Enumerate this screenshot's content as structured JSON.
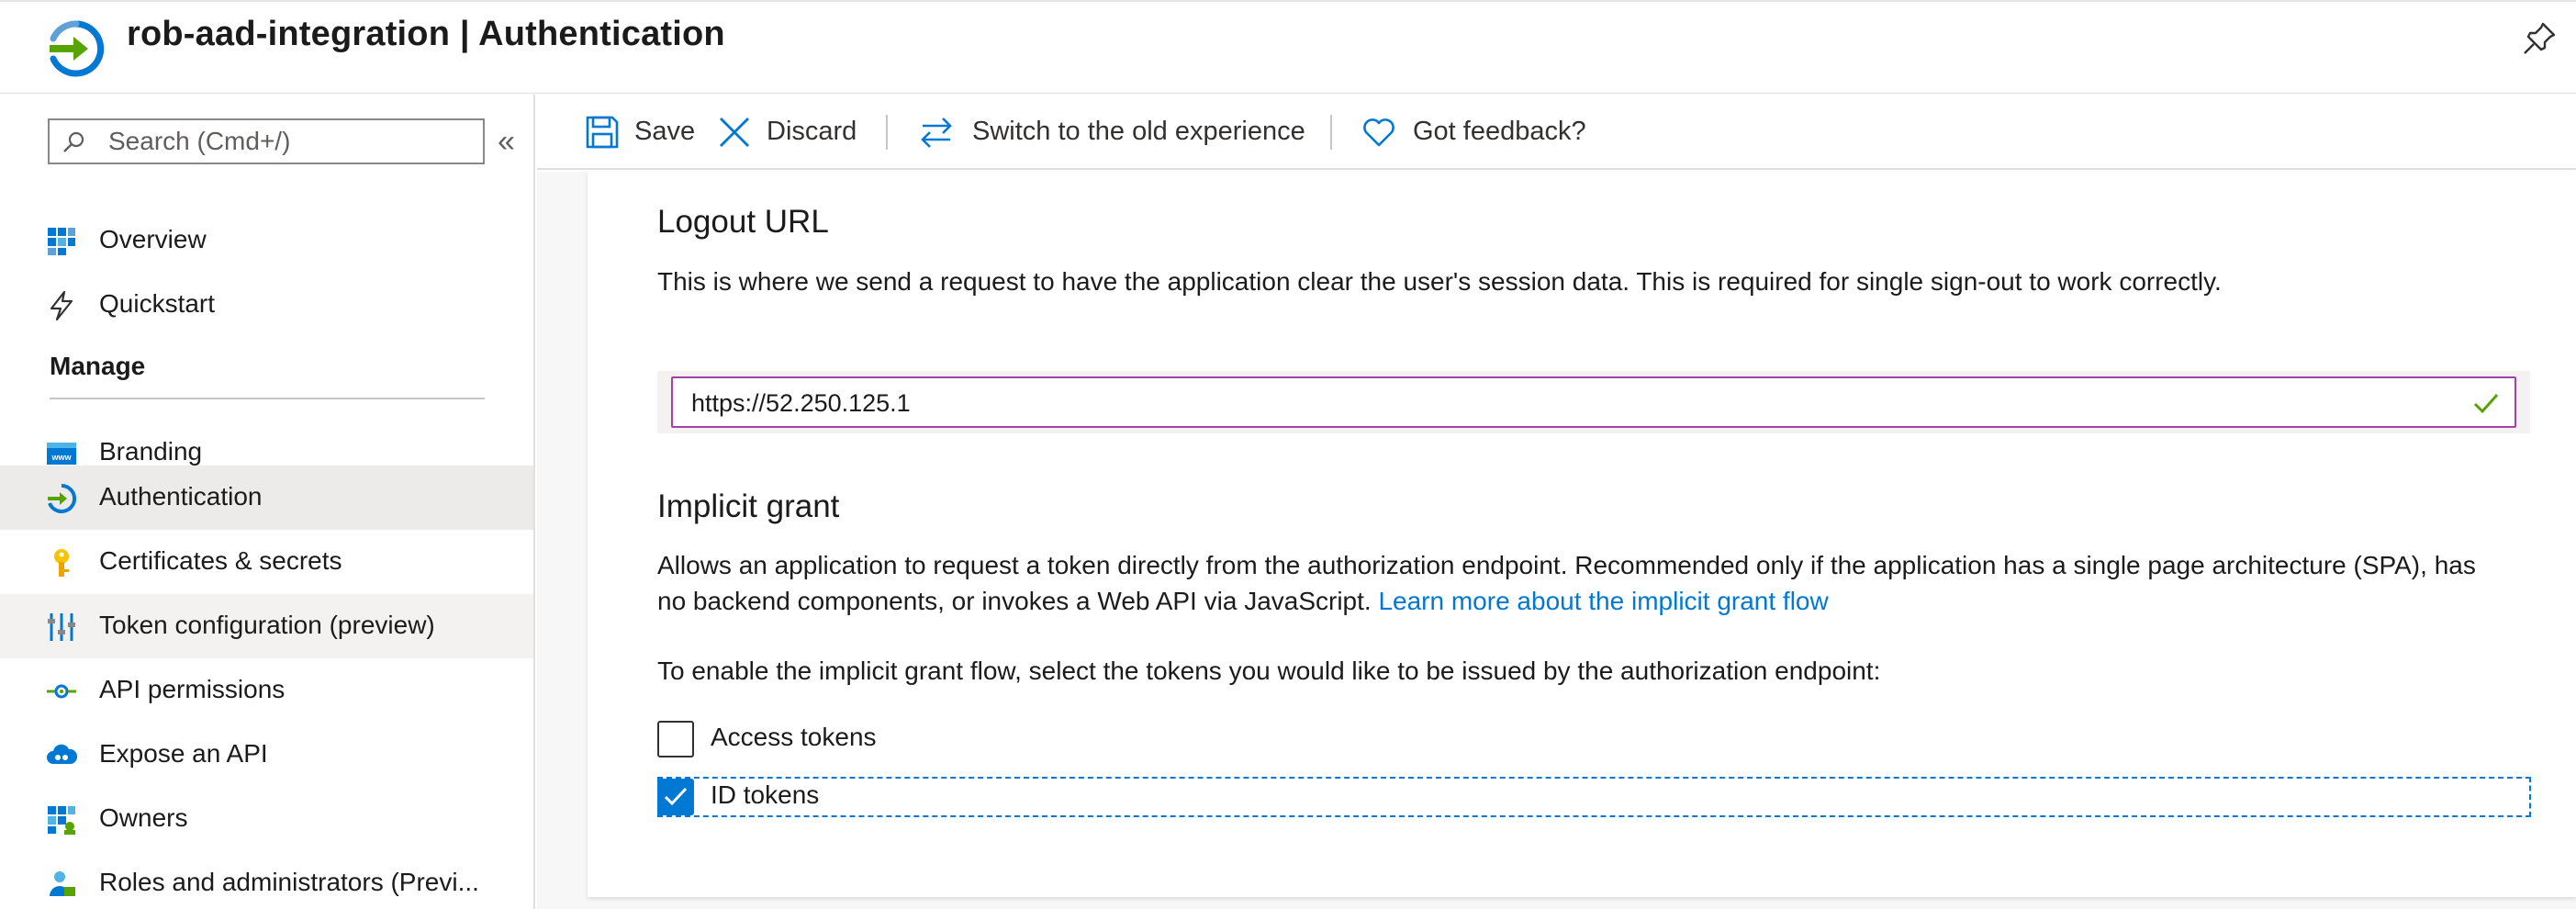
{
  "header": {
    "title": "rob-aad-integration | Authentication",
    "app_icon": "azure-app-arrow-icon",
    "pin_icon": "pin-icon"
  },
  "sidebar": {
    "search_placeholder": "Search (Cmd+/)",
    "collapse_glyph": "«",
    "top_items": [
      {
        "label": "Overview",
        "icon": "overview-grid-icon"
      },
      {
        "label": "Quickstart",
        "icon": "lightning-icon"
      }
    ],
    "manage_heading": "Manage",
    "items": [
      {
        "label": "Branding",
        "icon": "branding-www-icon"
      },
      {
        "label": "Authentication",
        "icon": "authentication-arrow-icon",
        "selected": true
      },
      {
        "label": "Certificates & secrets",
        "icon": "key-icon"
      },
      {
        "label": "Token configuration (preview)",
        "icon": "sliders-icon"
      },
      {
        "label": "API permissions",
        "icon": "api-permissions-icon"
      },
      {
        "label": "Expose an API",
        "icon": "cloud-icon"
      },
      {
        "label": "Owners",
        "icon": "owners-grid-icon"
      },
      {
        "label": "Roles and administrators (Previ..."
      }
    ]
  },
  "toolbar": {
    "save": "Save",
    "discard": "Discard",
    "switch": "Switch to the old experience",
    "feedback": "Got feedback?"
  },
  "logout": {
    "heading": "Logout URL",
    "description": "This is where we send a request to have the application clear the user's session data. This is required for single sign-out to work correctly.",
    "url_value": "https://52.250.125.1"
  },
  "implicit": {
    "heading": "Implicit grant",
    "description_line1": "Allows an application to request a token directly from the authorization endpoint. Recommended only if the application has a single page architecture (SPA), has",
    "description_line2": "no backend components, or invokes a Web API via JavaScript.",
    "learn_more": "Learn more about the implicit grant flow",
    "instruction": "To enable the implicit grant flow, select the tokens you would like to be issued by the authorization endpoint:",
    "access_tokens_label": "Access tokens",
    "access_tokens_checked": false,
    "id_tokens_label": "ID tokens",
    "id_tokens_checked": true
  },
  "colors": {
    "accent": "#0078d4",
    "input_focus_border": "#a541a6",
    "valid_check": "#57a300",
    "selected_nav_bg": "#edebe9"
  }
}
